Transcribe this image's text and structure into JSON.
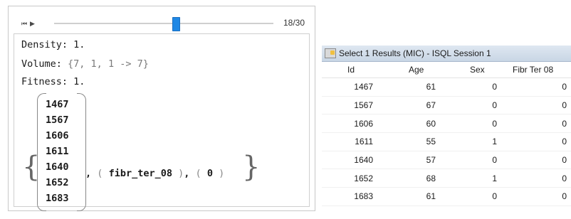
{
  "manipulate": {
    "buttons": {
      "first": "⏮",
      "play": "▶"
    },
    "slider": {
      "value": 18,
      "max": 30,
      "label": "18/30"
    },
    "density_label": "Density:",
    "density_value": "1.",
    "volume_label": "Volume:",
    "volume_value": "{7, 1, 1 -> 7}",
    "fitness_label": "Fitness:",
    "fitness_value": "1.",
    "ids": [
      "1467",
      "1567",
      "1606",
      "1611",
      "1640",
      "1652",
      "1683"
    ],
    "tail": {
      "sep": ",",
      "feature": "fibr_ter_08",
      "sep2": ",",
      "value": "0"
    }
  },
  "sql": {
    "title": "Select 1 Results (MIC) - ISQL Session 1",
    "columns": [
      "Id",
      "Age",
      "Sex",
      "Fibr Ter 08"
    ],
    "rows": [
      [
        "1467",
        "61",
        "0",
        "0"
      ],
      [
        "1567",
        "67",
        "0",
        "0"
      ],
      [
        "1606",
        "60",
        "0",
        "0"
      ],
      [
        "1611",
        "55",
        "1",
        "0"
      ],
      [
        "1640",
        "57",
        "0",
        "0"
      ],
      [
        "1652",
        "68",
        "1",
        "0"
      ],
      [
        "1683",
        "61",
        "0",
        "0"
      ]
    ]
  }
}
